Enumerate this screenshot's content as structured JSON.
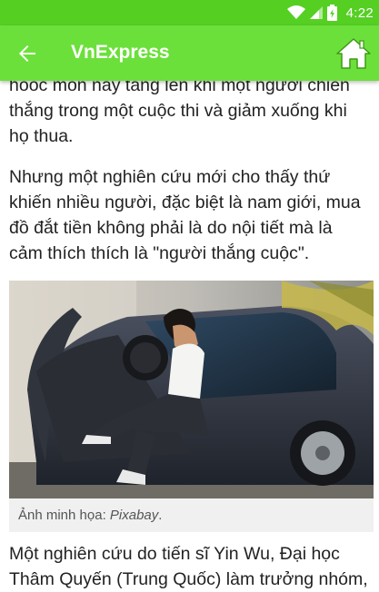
{
  "status_bar": {
    "time": "4:22",
    "icons": [
      "wifi-icon",
      "signal-icon",
      "battery-icon"
    ]
  },
  "app_bar": {
    "title": "VnExpress",
    "back_icon": "arrow-left-icon",
    "home_icon": "home-icon"
  },
  "article": {
    "paragraph_1": "hoóc môn này tăng lên khi một người chiến thắng trong một cuộc thi và giảm xuống khi họ thua.",
    "paragraph_2": "Nhưng một nghiên cứu mới cho thấy thứ khiến nhiều người, đặc biệt là nam giới, mua đồ đắt tiền không phải là do nội tiết mà là cảm thích thích là \"người thắng cuộc\".",
    "image_caption_prefix": "Ảnh minh họa: ",
    "image_caption_source": "Pixabay",
    "image_caption_suffix": ".",
    "paragraph_3": "Một nghiên cứu do tiến sĩ Yin Wu, Đại học Thâm Quyến (Trung Quốc) làm trưởng nhóm,"
  },
  "colors": {
    "status_bar": "#56cf23",
    "app_bar": "#6be03a",
    "text": "#222222",
    "caption_bg": "#f0f0f0"
  }
}
